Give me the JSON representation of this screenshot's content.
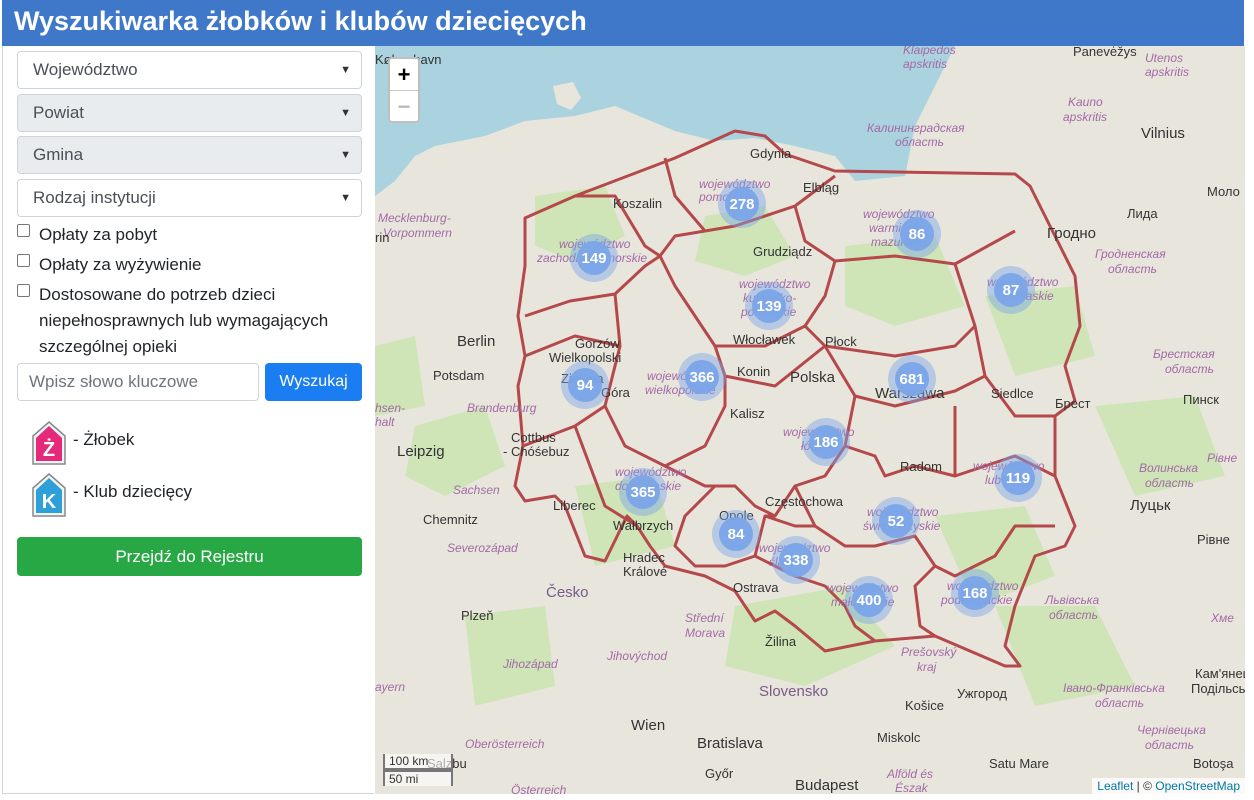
{
  "header": {
    "title": "Wyszukiwarka żłobków i klubów dziecięcych"
  },
  "filters": {
    "voivodeship": "Województwo",
    "county": "Powiat",
    "municipality": "Gmina",
    "institution_type": "Rodzaj instytucji"
  },
  "checkboxes": {
    "stay_fees": "Opłaty za pobyt",
    "meal_fees": "Opłaty za wyżywienie",
    "special_needs": "Dostosowane do potrzeb dzieci niepełnosprawnych lub wymagających szczególnej opieki"
  },
  "search": {
    "placeholder": "Wpisz słowo kluczowe",
    "button": "Wyszukaj"
  },
  "legend": {
    "nursery_letter": "Ż",
    "nursery_label": "- Żłobek",
    "nursery_color": "#e5287a",
    "club_letter": "K",
    "club_label": "- Klub dziecięcy",
    "club_color": "#2d9fd9"
  },
  "registry_button": "Przejdź do Rejestru",
  "map": {
    "zoom_in": "+",
    "zoom_out": "−",
    "scale_km": "100 km",
    "scale_mi": "50 mi",
    "attribution_leaflet": "Leaflet",
    "attribution_sep": " | © ",
    "attribution_osm": "OpenStreetMap",
    "cluster_color": "#7aa5e8",
    "border_color": "#b5484a",
    "clusters": [
      {
        "count": "278"
      },
      {
        "count": "86"
      },
      {
        "count": "149"
      },
      {
        "count": "139"
      },
      {
        "count": "87"
      },
      {
        "count": "94"
      },
      {
        "count": "366"
      },
      {
        "count": "681"
      },
      {
        "count": "186"
      },
      {
        "count": "119"
      },
      {
        "count": "365"
      },
      {
        "count": "84"
      },
      {
        "count": "52"
      },
      {
        "count": "338"
      },
      {
        "count": "400"
      },
      {
        "count": "168"
      }
    ],
    "places": {
      "kobenhavn": "København",
      "klaipedos": "Klaipėdos",
      "apskritis": "apskritis",
      "panevezys": "Panevėžys",
      "utenos": "Utenos",
      "utenos_ap": "apskritis",
      "kauno": "Kauno",
      "kauno_ap": "apskritis",
      "vilnius": "Vilnius",
      "kaliningrad1": "Калининградская",
      "kaliningrad2": "область",
      "gdynia": "Gdynia",
      "elblag": "Elbląg",
      "koszalin": "Koszalin",
      "mecklenburg1": "Mecklenburg-",
      "mecklenburg2": "Vorpommern",
      "grudziadz": "Grudziądz",
      "lida": "Лида",
      "grodno": "Гродно",
      "grodno_obl1": "Гродненская",
      "grodno_obl2": "область",
      "molo": "Моло",
      "rin": "rin",
      "berlin": "Berlin",
      "potsdam": "Potsdam",
      "brandenburg": "Brandenburg",
      "gorzow1": "Gorzów",
      "gorzow2": "Wielkopolski",
      "wloclawek": "Włocławek",
      "plock": "Płock",
      "konin": "Konin",
      "polska": "Polska",
      "warszawa": "Warszawa",
      "siedlce": "Siedlce",
      "brest": "Брест",
      "brest_obl1": "Брестская",
      "brest_obl2": "область",
      "pinsk": "Пинск",
      "kalisz": "Kalisz",
      "radom": "Radom",
      "sachsen_anh": "hsen-",
      "sachsen_anh2": "halt",
      "leipzig": "Leipzig",
      "cottbus1": "Cottbus",
      "cottbus2": "- Chóśebuz",
      "sachsen": "Sachsen",
      "chemnitz": "Chemnitz",
      "liberec": "Liberec",
      "walbrzych": "Wałbrzych",
      "opole": "Opole",
      "czestochowa": "Częstochowa",
      "hradec1": "Hradec",
      "hradec2": "Králové",
      "volyn1": "Волинська",
      "volyn2": "область",
      "rivne": "Рівне",
      "rivne2": "Рівне",
      "lutsk": "Луцьк",
      "cesko": "Česko",
      "severozapad": "Severozápad",
      "ostrava": "Ostrava",
      "plzen": "Plzeň",
      "stredni1": "Střední",
      "stredni2": "Morava",
      "lviv1": "Львівська",
      "lviv2": "область",
      "jihozapad": "Jihozápad",
      "jihovychod": "Jihovýchod",
      "zilina": "Žilina",
      "presov1": "Prešovský",
      "presov2": "kraj",
      "slovensko": "Slovensko",
      "uzhhorod": "Ужгород",
      "ivano1": "Івано-Франківська",
      "ivano2": "область",
      "kamyanets1": "Кам'янец",
      "kamyanets2": "Подільсь",
      "kosice": "Košice",
      "chernivtsi1": "Чернівецька",
      "chernivtsi2": "область",
      "bayern": "ayern",
      "wien": "Wien",
      "bratislava": "Bratislava",
      "miskolc": "Miskolc",
      "oberosterreich": "Oberösterreich",
      "salzburg": "Salzbu",
      "gyor": "Győr",
      "budapest": "Budapest",
      "satu_mare": "Satu Mare",
      "alfold1": "Alföld és",
      "alfold2": "Észak",
      "botosa": "Botoşa",
      "osterreich": "Österreich",
      "hme": "Хме"
    },
    "region_labels": {
      "pomorskie1": "województwo",
      "pomorskie2": "pomorskie",
      "warm1": "województwo",
      "warm2": "warmińsko-",
      "warm3": "mazurskie",
      "zach1": "województwo",
      "zach2": "zachodniopomorskie",
      "kuj1": "województwo",
      "kuj2": "kujawsko-",
      "kuj3": "pomorskie",
      "podl1": "województwo",
      "podl2": "podlaskie",
      "wlkp1": "województwo",
      "wlkp2": "wielkopolskie",
      "lodz1": "województwo",
      "lodz2": "łódzkie",
      "lub1": "województwo",
      "lub2": "lubelskie",
      "dolno1": "województwo",
      "dolno2": "dolnośląskie",
      "swie1": "województwo",
      "swie2": "świętokrzyskie",
      "slask1": "województwo",
      "slask2": "śląskie",
      "malo1": "województwo",
      "malo2": "małopolskie",
      "podk1": "województwo",
      "podk2": "podkarpackie",
      "lubus1": "Zielona",
      "lubus2": "Góra"
    }
  }
}
